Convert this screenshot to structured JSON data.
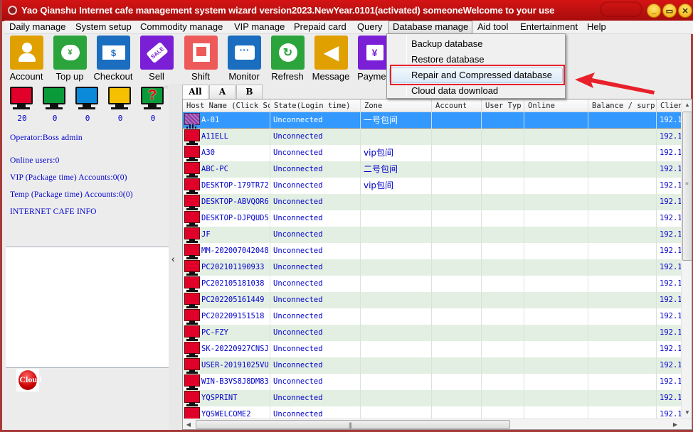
{
  "window": {
    "title": "Yao Qianshu Internet cafe management system wizard version2023.NewYear.0101(activated)  someoneWelcome to your use",
    "controls": {
      "minimize": "_",
      "maximize": "▭",
      "close": "✕"
    }
  },
  "menubar": {
    "items": [
      {
        "label": "Daily manage"
      },
      {
        "label": "System setup"
      },
      {
        "label": "Commodity manage"
      },
      {
        "label": "VIP manage"
      },
      {
        "label": "Prepaid card"
      },
      {
        "label": "Query"
      },
      {
        "label": "Database manage",
        "open": true
      },
      {
        "label": "Aid tool"
      },
      {
        "label": "Entertainment"
      },
      {
        "label": "Help"
      }
    ]
  },
  "dropdown": {
    "items": [
      {
        "label": "Backup database"
      },
      {
        "label": "Restore database"
      },
      {
        "label": "Repair and Compressed database",
        "highlighted": true
      },
      {
        "label": "Cloud data download"
      }
    ]
  },
  "toolbar": {
    "buttons": [
      {
        "label": "Account",
        "icon": "account-icon",
        "color": "#e0a000"
      },
      {
        "label": "Top up",
        "icon": "piggy-bank-icon",
        "color": "#2aa43b"
      },
      {
        "label": "Checkout",
        "icon": "bill-icon",
        "color": "#1a6dbf",
        "glyph": "$"
      },
      {
        "label": "Sell",
        "icon": "sale-tag-icon",
        "color": "#7a1fd6",
        "glyph": "SALE"
      },
      {
        "label": "Shift",
        "icon": "shift-icon",
        "color": "#ee5a5a"
      },
      {
        "label": "Monitor",
        "icon": "chat-bubble-icon",
        "color": "#1a6dbf",
        "glyph": "···"
      },
      {
        "label": "Refresh",
        "icon": "refresh-icon",
        "color": "#2aa43b",
        "glyph": "↻"
      },
      {
        "label": "Message",
        "icon": "speaker-icon",
        "color": "#e0a000",
        "glyph": "◀"
      },
      {
        "label": "Paymen",
        "icon": "yen-icon",
        "color": "#7a1fd6",
        "glyph": "¥"
      }
    ]
  },
  "status_panel": {
    "monitors": [
      {
        "state": "red",
        "color": "#e0002a",
        "count": "20"
      },
      {
        "state": "green",
        "color": "#0a9a3a",
        "count": "0"
      },
      {
        "state": "blue",
        "color": "#0a8ad8",
        "count": "0"
      },
      {
        "state": "yellow",
        "color": "#f5c000",
        "count": "0"
      },
      {
        "state": "unknown",
        "color": "#0a9a3a",
        "count": "0",
        "glyph": "?"
      }
    ],
    "operator": "Operator:Boss admin",
    "online_users": "Online users:0",
    "vip_accounts": "VIP (Package time) Accounts:0(0)",
    "temp_accounts": "Temp (Package time) Accounts:0(0)",
    "cafe_info": "INTERNET CAFE  INFO",
    "cloud_button": "Cloud"
  },
  "splitter": {
    "collapse_glyph": "‹"
  },
  "tabs": [
    {
      "label": "All",
      "active": true
    },
    {
      "label": "A"
    },
    {
      "label": "B"
    }
  ],
  "grid": {
    "columns": [
      "Host Name (Click Sc",
      "State(Login time)",
      "Zone",
      "Account",
      "User Typ",
      "Online",
      "Balance / surp!",
      "Clien"
    ],
    "rows": [
      {
        "host": "A-01",
        "state": "Unconnected",
        "zone": "一号包间",
        "account": "",
        "user_type": "",
        "online": "",
        "balance": "",
        "client": "192.1",
        "selected": true
      },
      {
        "host": "A11ELL",
        "state": "Unconnected",
        "zone": "",
        "account": "",
        "user_type": "",
        "online": "",
        "balance": "",
        "client": "192.1"
      },
      {
        "host": "A30",
        "state": "Unconnected",
        "zone": "vip包间",
        "account": "",
        "user_type": "",
        "online": "",
        "balance": "",
        "client": "192.1"
      },
      {
        "host": "ABC-PC",
        "state": "Unconnected",
        "zone": "二号包间",
        "account": "",
        "user_type": "",
        "online": "",
        "balance": "",
        "client": "192.1"
      },
      {
        "host": "DESKTOP-179TR72",
        "state": "Unconnected",
        "zone": "vip包间",
        "account": "",
        "user_type": "",
        "online": "",
        "balance": "",
        "client": "192.1"
      },
      {
        "host": "DESKTOP-ABVQOR6",
        "state": "Unconnected",
        "zone": "",
        "account": "",
        "user_type": "",
        "online": "",
        "balance": "",
        "client": "192.1"
      },
      {
        "host": "DESKTOP-DJPQUD5",
        "state": "Unconnected",
        "zone": "",
        "account": "",
        "user_type": "",
        "online": "",
        "balance": "",
        "client": "192.1"
      },
      {
        "host": "JF",
        "state": "Unconnected",
        "zone": "",
        "account": "",
        "user_type": "",
        "online": "",
        "balance": "",
        "client": "192.1"
      },
      {
        "host": "MM-202007042048",
        "state": "Unconnected",
        "zone": "",
        "account": "",
        "user_type": "",
        "online": "",
        "balance": "",
        "client": "192.1"
      },
      {
        "host": "PC202101190933",
        "state": "Unconnected",
        "zone": "",
        "account": "",
        "user_type": "",
        "online": "",
        "balance": "",
        "client": "192.1"
      },
      {
        "host": "PC202105181038",
        "state": "Unconnected",
        "zone": "",
        "account": "",
        "user_type": "",
        "online": "",
        "balance": "",
        "client": "192.1"
      },
      {
        "host": "PC202205161449",
        "state": "Unconnected",
        "zone": "",
        "account": "",
        "user_type": "",
        "online": "",
        "balance": "",
        "client": "192.1"
      },
      {
        "host": "PC202209151518",
        "state": "Unconnected",
        "zone": "",
        "account": "",
        "user_type": "",
        "online": "",
        "balance": "",
        "client": "192.1"
      },
      {
        "host": "PC-FZY",
        "state": "Unconnected",
        "zone": "",
        "account": "",
        "user_type": "",
        "online": "",
        "balance": "",
        "client": "192.1"
      },
      {
        "host": "SK-20220927CNSJ",
        "state": "Unconnected",
        "zone": "",
        "account": "",
        "user_type": "",
        "online": "",
        "balance": "",
        "client": "192.1"
      },
      {
        "host": "USER-20191025VU",
        "state": "Unconnected",
        "zone": "",
        "account": "",
        "user_type": "",
        "online": "",
        "balance": "",
        "client": "192.1"
      },
      {
        "host": "WIN-B3VS8J8DM83",
        "state": "Unconnected",
        "zone": "",
        "account": "",
        "user_type": "",
        "online": "",
        "balance": "",
        "client": "192.1"
      },
      {
        "host": "YQSPRINT",
        "state": "Unconnected",
        "zone": "",
        "account": "",
        "user_type": "",
        "online": "",
        "balance": "",
        "client": "192.1"
      },
      {
        "host": "YQSWELCOME2",
        "state": "Unconnected",
        "zone": "",
        "account": "",
        "user_type": "",
        "online": "",
        "balance": "",
        "client": "192.1"
      }
    ],
    "scroll": {
      "up": "▲",
      "down": "▼",
      "left": "◀",
      "right": "▶",
      "vgrip": "≡",
      "hgrip": "|||"
    }
  },
  "annotation": {
    "color": "#e8202a"
  }
}
